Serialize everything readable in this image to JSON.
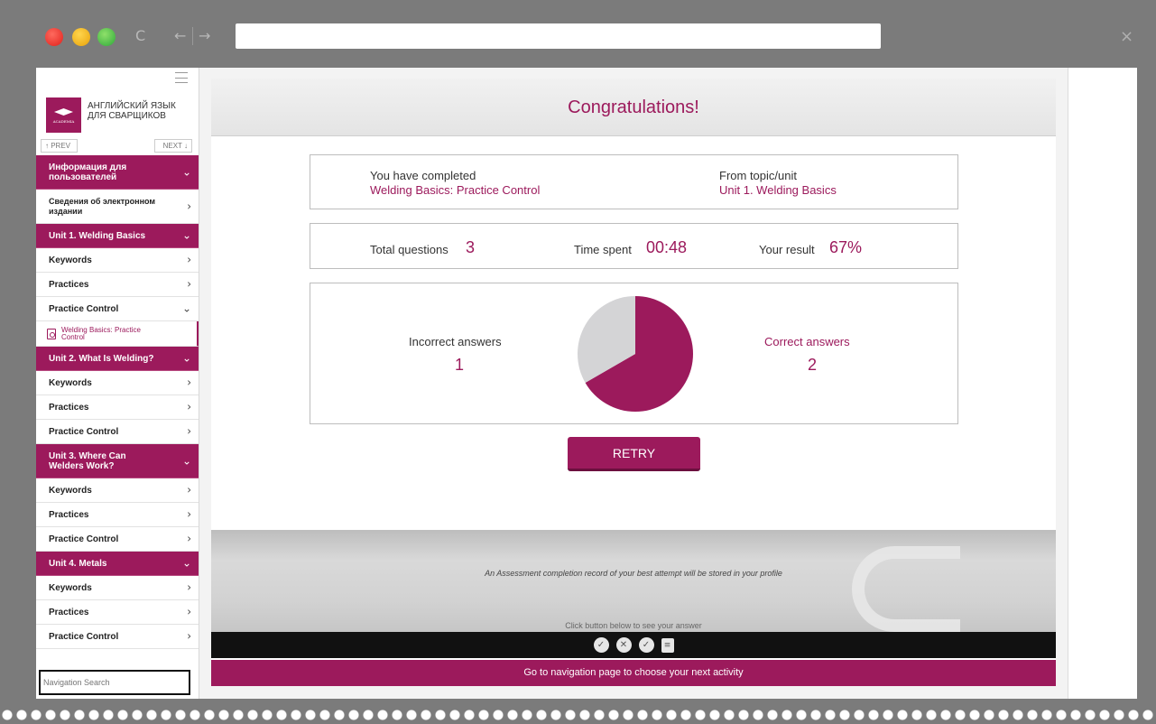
{
  "browser": {
    "reload_icon": "C",
    "back_icon": "←",
    "forward_icon": "→",
    "close_icon": "×"
  },
  "sidebar": {
    "brand_line1": "АНГЛИЙСКИЙ ЯЗЫК",
    "brand_line2": "ДЛЯ СВАРЩИКОВ",
    "logo_text": "ACADEMIA",
    "prev_label": "↑ PREV",
    "next_label": "NEXT ↓",
    "search_placeholder": "Navigation Search",
    "items": [
      {
        "label": "Информация для пользователей",
        "type": "section"
      },
      {
        "label": "Сведения об электронном издании",
        "type": "item"
      },
      {
        "label": "Unit 1. Welding Basics",
        "type": "section"
      },
      {
        "label": "Keywords",
        "type": "item"
      },
      {
        "label": "Practices",
        "type": "item"
      },
      {
        "label": "Practice Control",
        "type": "item-open"
      },
      {
        "label": "Welding Basics: Practice Control",
        "type": "active"
      },
      {
        "label": "Unit 2. What Is Welding?",
        "type": "section"
      },
      {
        "label": "Keywords",
        "type": "item"
      },
      {
        "label": "Practices",
        "type": "item"
      },
      {
        "label": "Practice Control",
        "type": "item"
      },
      {
        "label": "Unit 3. Where Can Welders Work?",
        "type": "section"
      },
      {
        "label": "Keywords",
        "type": "item"
      },
      {
        "label": "Practices",
        "type": "item"
      },
      {
        "label": "Practice Control",
        "type": "item"
      },
      {
        "label": "Unit 4. Metals",
        "type": "section"
      },
      {
        "label": "Keywords",
        "type": "item"
      },
      {
        "label": "Practices",
        "type": "item"
      },
      {
        "label": "Practice Control",
        "type": "item"
      }
    ]
  },
  "main": {
    "title": "Congratulations!",
    "completed_label": "You have completed",
    "completed_value": "Welding Basics: Practice Control",
    "topic_label": "From topic/unit",
    "topic_value": "Unit 1. Welding Basics",
    "total_label": "Total questions",
    "total_value": "3",
    "time_label": "Time spent",
    "time_value": "00:48",
    "result_label": "Your result",
    "result_value": "67%",
    "incorrect_label": "Incorrect answers",
    "incorrect_value": "1",
    "correct_label": "Correct answers",
    "correct_value": "2",
    "retry_label": "RETRY",
    "note": "An Assessment completion record of your best attempt will be stored in your profile",
    "hint": "Click button below to see your answer",
    "answer_icons": [
      "check-icon",
      "cross-icon",
      "check-icon",
      "sheet-icon"
    ],
    "nav_text": "Go to navigation page to choose your next activity"
  },
  "colors": {
    "accent": "#9c1a5c",
    "pie_correct": "#9c1a5c",
    "pie_incorrect": "#d4d4d6"
  },
  "chart_data": {
    "type": "pie",
    "categories": [
      "Correct answers",
      "Incorrect answers"
    ],
    "values": [
      2,
      1
    ]
  }
}
